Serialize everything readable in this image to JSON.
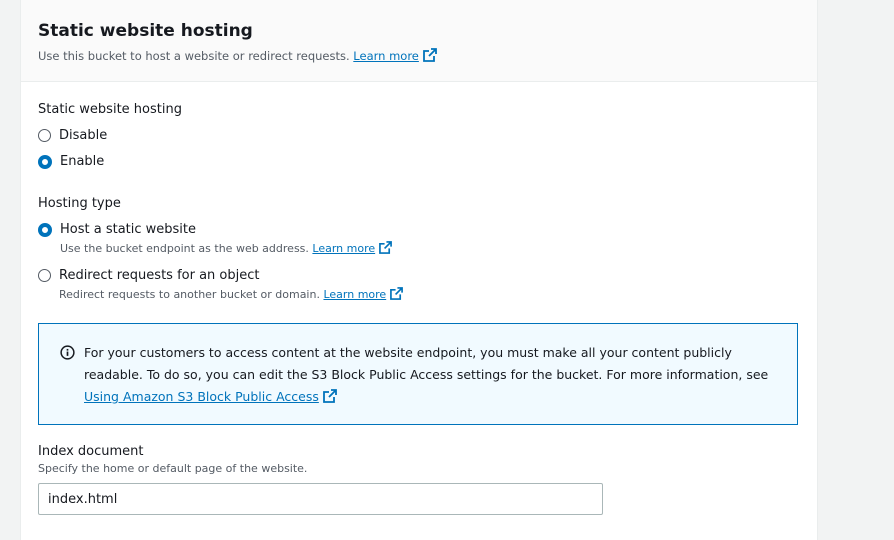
{
  "panel": {
    "title": "Static website hosting",
    "description": "Use this bucket to host a website or redirect requests.",
    "learn_more": "Learn more"
  },
  "hosting_toggle": {
    "label": "Static website hosting",
    "options": [
      {
        "label": "Disable",
        "selected": false
      },
      {
        "label": "Enable",
        "selected": true
      }
    ]
  },
  "hosting_type": {
    "label": "Hosting type",
    "options": [
      {
        "label": "Host a static website",
        "description": "Use the bucket endpoint as the web address.",
        "learn_more": "Learn more",
        "selected": true
      },
      {
        "label": "Redirect requests for an object",
        "description": "Redirect requests to another bucket or domain.",
        "learn_more": "Learn more",
        "selected": false
      }
    ]
  },
  "info": {
    "text": "For your customers to access content at the website endpoint, you must make all your content publicly readable. To do so, you can edit the S3 Block Public Access settings for the bucket. For more information, see",
    "link": "Using Amazon S3 Block Public Access"
  },
  "index_document": {
    "label": "Index document",
    "description": "Specify the home or default page of the website.",
    "value": "index.html"
  },
  "colors": {
    "accent": "#0073bb",
    "info_bg": "#f1faff"
  }
}
